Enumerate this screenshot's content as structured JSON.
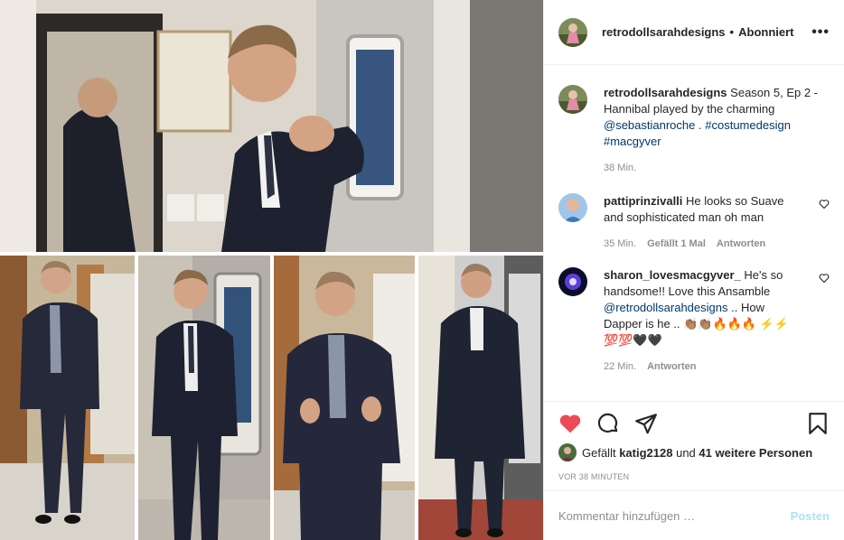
{
  "post": {
    "photo_icon": "collage-photo",
    "panels": [
      "man-pointing-in-trailer",
      "man-standing-pinstripe-suit",
      "man-standing-dark-suit",
      "man-thumbs-up",
      "man-in-overcoat"
    ]
  },
  "header": {
    "username": "retrodollsarahdesigns",
    "separator": "•",
    "follow_label": "Abonniert",
    "more_label": "•••"
  },
  "caption": {
    "username": "retrodollsarahdesigns",
    "text": "Season 5, Ep 2 - Hannibal played by the charming",
    "mention": "@sebastianroche",
    "text2": ".",
    "tag1": "#costumedesign",
    "tag2": "#macgyver",
    "time": "38 Min."
  },
  "comments": [
    {
      "username": "pattiprinzivalli",
      "text": "He looks so Suave and sophisticated man oh man",
      "time": "35 Min.",
      "likes": "Gefällt 1 Mal",
      "reply": "Antworten"
    },
    {
      "username": "sharon_lovesmacgyver_",
      "text": "He's so handsome!! Love this Ansamble",
      "mention": "@retrodollsarahdesigns",
      "text2": ".. How Dapper is he .. 👏🏽👏🏽🔥🔥🔥 ⚡⚡ 💯💯🖤🖤",
      "time": "22 Min.",
      "reply": "Antworten"
    }
  ],
  "likes": {
    "prefix": "Gefällt",
    "user": "katig2128",
    "middle": "und",
    "count": "41 weitere Personen"
  },
  "timestamp": "VOR 38 MINUTEN",
  "add_comment": {
    "placeholder": "Kommentar hinzufügen …",
    "post_label": "Posten"
  },
  "colors": {
    "heart": "#ed4956",
    "link": "#00376b",
    "post_disabled": "#b2dffc"
  }
}
